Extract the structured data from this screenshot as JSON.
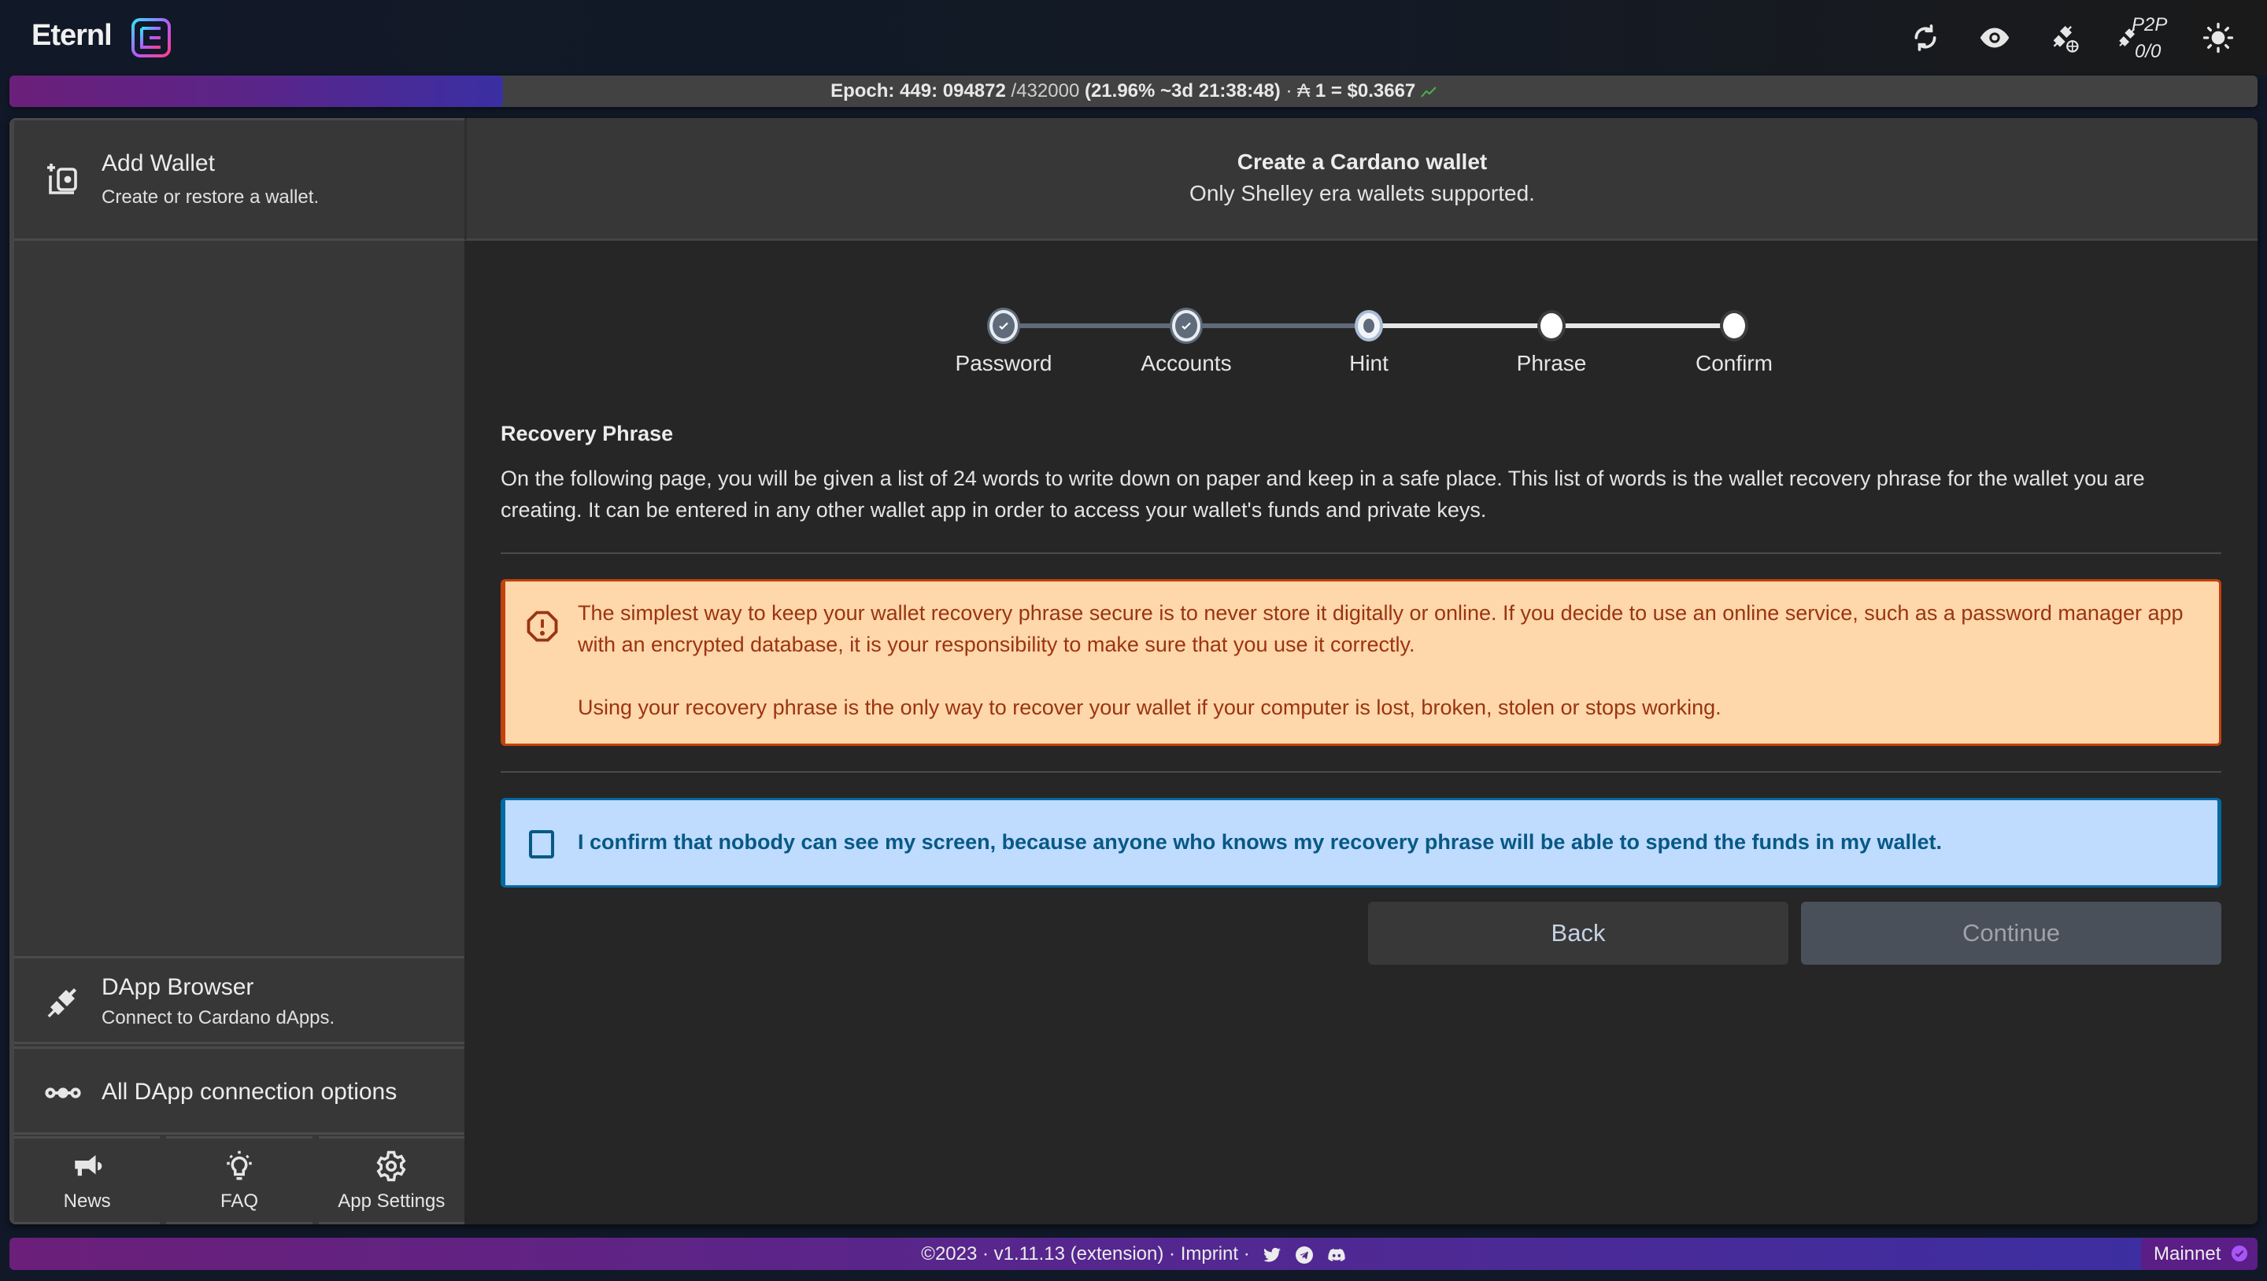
{
  "app": {
    "name": "Eternl",
    "logo_icon": "eternl-logo-icon"
  },
  "topbar": {
    "icons": [
      "sync-icon",
      "eye-icon",
      "plug-globe-icon",
      "p2p-plug-icon",
      "sun-icon"
    ],
    "p2p_label": "P2P",
    "p2p_count": "0/0"
  },
  "epoch": {
    "label": "Epoch: 449: 094872",
    "slot_total": "/432000",
    "progress_text": "(21.96% ~3d 21:38:48)",
    "separator": "·",
    "ada_symbol": "₳",
    "price_text": "1 = $0.3667",
    "progress_percent": 21.96,
    "trend_icon": "trend-up-icon"
  },
  "sidebar": {
    "add_wallet": {
      "title": "Add Wallet",
      "subtitle": "Create or restore a wallet.",
      "icon": "add-wallet-icon"
    },
    "dapp_browser": {
      "title": "DApp Browser",
      "subtitle": "Connect to Cardano dApps.",
      "icon": "plug-icon"
    },
    "dapp_options": {
      "title": "All DApp connection options",
      "icon": "connection-dots-icon"
    },
    "tiles": [
      {
        "label": "News",
        "icon": "megaphone-icon"
      },
      {
        "label": "FAQ",
        "icon": "lightbulb-icon"
      },
      {
        "label": "App Settings",
        "icon": "gear-icon"
      }
    ]
  },
  "content": {
    "header": {
      "title": "Create a Cardano wallet",
      "subtitle": "Only Shelley era wallets supported."
    },
    "stepper": {
      "steps": [
        {
          "label": "Password",
          "state": "done"
        },
        {
          "label": "Accounts",
          "state": "done"
        },
        {
          "label": "Hint",
          "state": "active"
        },
        {
          "label": "Phrase",
          "state": "todo"
        },
        {
          "label": "Confirm",
          "state": "todo"
        }
      ]
    },
    "recovery": {
      "title": "Recovery Phrase",
      "text": "On the following page, you will be given a list of 24 words to write down on paper and keep in a safe place. This list of words is the wallet recovery phrase for the wallet you are creating. It can be entered in any other wallet app in order to access your wallet's funds and private keys."
    },
    "warning": {
      "icon": "alert-octagon-icon",
      "paragraph1": "The simplest way to keep your wallet recovery phrase secure is to never store it digitally or online. If you decide to use an online service, such as a password manager app with an encrypted database, it is your responsibility to make sure that you use it correctly.",
      "paragraph2": "Using your recovery phrase is the only way to recover your wallet if your computer is lost, broken, stolen or stops working."
    },
    "confirm": {
      "checked": false,
      "label": "I confirm that nobody can see my screen, because anyone who knows my recovery phrase will be able to spend the funds in my wallet."
    },
    "buttons": {
      "back": "Back",
      "continue": "Continue"
    }
  },
  "footer": {
    "copyright": "©2023 · v1.11.13 (extension) · ",
    "imprint": "Imprint",
    "sep": " · ",
    "social": [
      "twitter-icon",
      "telegram-icon",
      "discord-icon"
    ],
    "network": "Mainnet",
    "network_icon": "check-circle-icon"
  },
  "colors": {
    "accent_purple": "#6b1f7a",
    "accent_indigo": "#3a2fa3",
    "warning_bg": "#fed7aa",
    "warning_border": "#c2410c",
    "info_bg": "#bfdbfe",
    "info_border": "#0369a1"
  }
}
